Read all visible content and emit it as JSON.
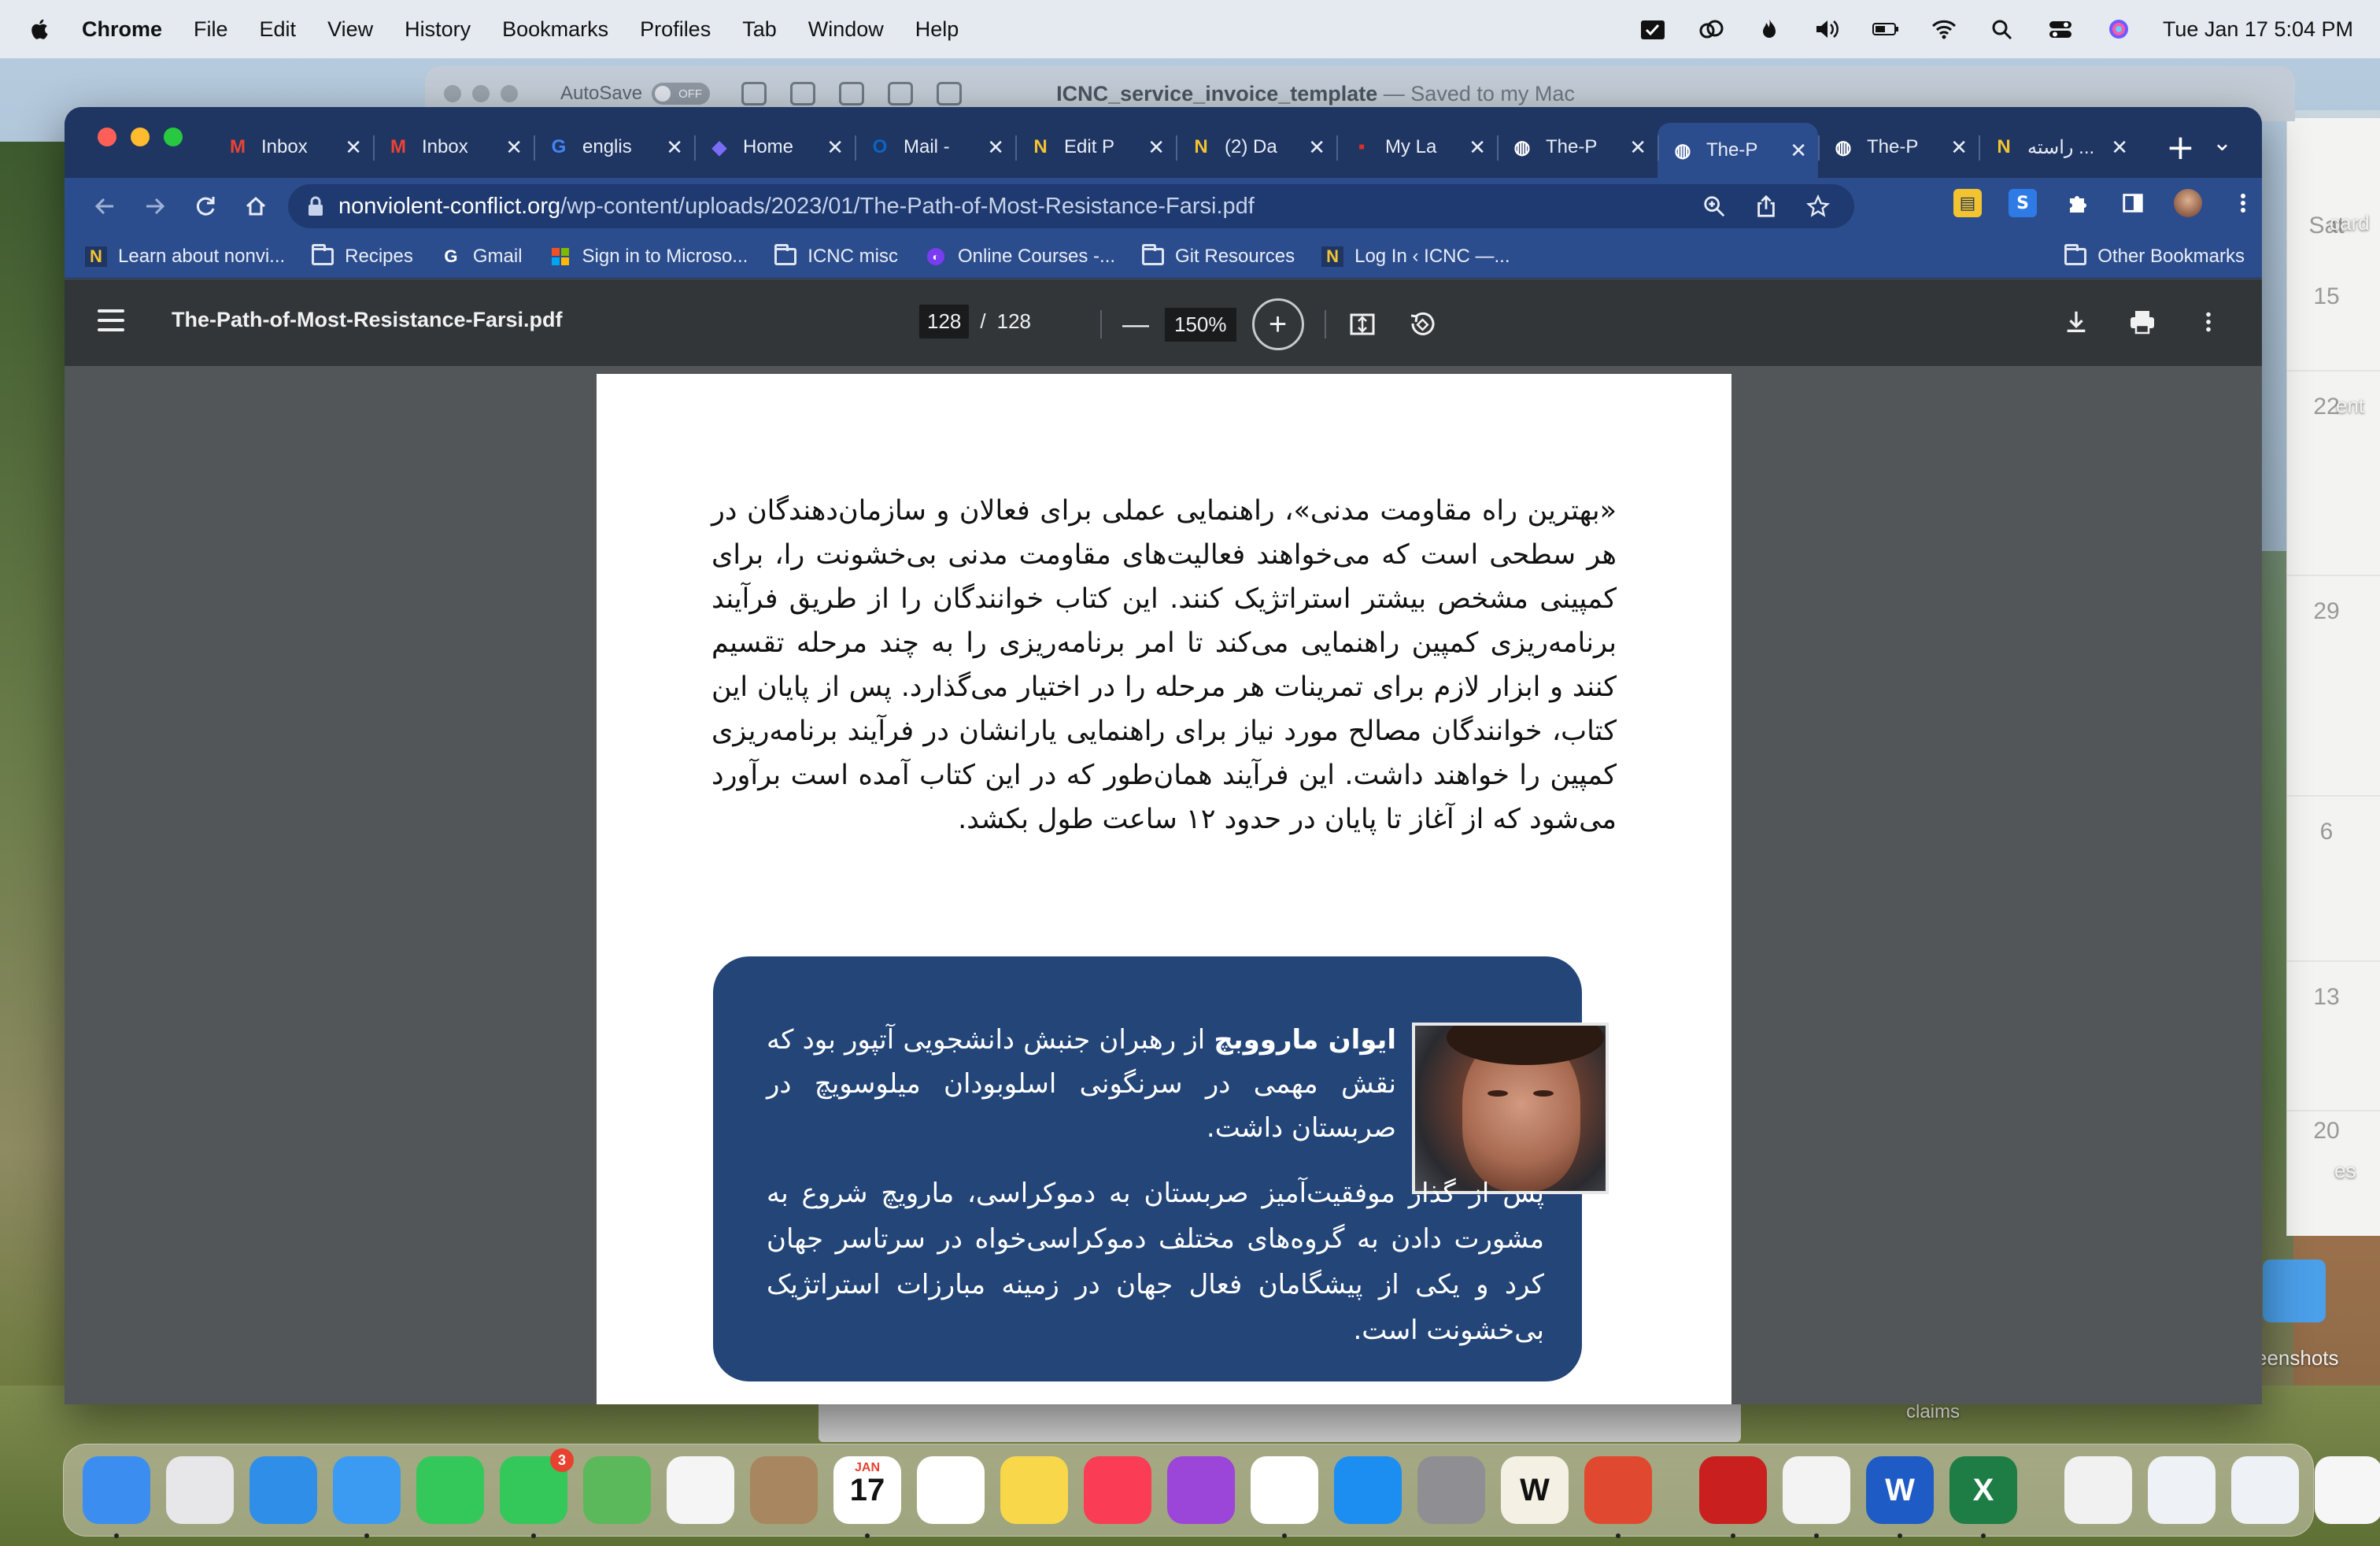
{
  "menubar": {
    "app_name": "Chrome",
    "items": [
      "File",
      "Edit",
      "View",
      "History",
      "Bookmarks",
      "Profiles",
      "Tab",
      "Window",
      "Help"
    ],
    "datetime": "Tue Jan 17  5:04 PM"
  },
  "back_window": {
    "autosave_label": "AutoSave",
    "toggle_label": "OFF",
    "doc_title": "ICNC_service_invoice_template",
    "doc_status": " — Saved to my Mac"
  },
  "side_window": {
    "label_card": "card",
    "label_sat": "Sat",
    "days": [
      "15",
      "22",
      "29",
      "6",
      "13",
      "20"
    ],
    "label_ent": "ent",
    "label_es": "es",
    "label_screenshots": "eenshots"
  },
  "tabs": [
    {
      "label": "Inbox",
      "icon": "gmail-icon",
      "color": "#ea4335"
    },
    {
      "label": "Inbox",
      "icon": "gmail-icon",
      "color": "#ea4335"
    },
    {
      "label": "englis",
      "icon": "google-icon",
      "color": "#4285f4"
    },
    {
      "label": "Home",
      "icon": "copilot-icon",
      "color": "#7b6cf6"
    },
    {
      "label": "Mail -",
      "icon": "outlook-icon",
      "color": "#0a64c8"
    },
    {
      "label": "Edit P",
      "icon": "n-icon",
      "color": "#f4c430"
    },
    {
      "label": "(2) Da",
      "icon": "n-icon",
      "color": "#f4c430"
    },
    {
      "label": "My La",
      "icon": "dots-icon",
      "color": "#d93025"
    },
    {
      "label": "The-P",
      "icon": "globe-icon",
      "color": "#ffffff"
    },
    {
      "label": "The-P",
      "icon": "globe-icon",
      "color": "#ffffff",
      "active": true
    },
    {
      "label": "The-P",
      "icon": "globe-icon",
      "color": "#ffffff"
    },
    {
      "label": "راسته ...",
      "icon": "n-icon",
      "color": "#f4c430"
    }
  ],
  "toolbar": {
    "url_host": "nonviolent-conflict.org",
    "url_path": "/wp-content/uploads/2023/01/The-Path-of-Most-Resistance-Farsi.pdf"
  },
  "bookmarks": [
    {
      "label": "Learn about nonvi...",
      "icon": "n-icon"
    },
    {
      "label": "Recipes",
      "icon": "folder-icon"
    },
    {
      "label": "Gmail",
      "icon": "google-icon"
    },
    {
      "label": "Sign in to Microso...",
      "icon": "microsoft-icon"
    },
    {
      "label": "ICNC misc",
      "icon": "folder-icon"
    },
    {
      "label": "Online Courses -...",
      "icon": "course-icon"
    },
    {
      "label": "Git Resources",
      "icon": "folder-icon"
    },
    {
      "label": "Log In ‹ ICNC —...",
      "icon": "n-icon"
    }
  ],
  "other_bookmarks": "Other Bookmarks",
  "pdf": {
    "filename": "The-Path-of-Most-Resistance-Farsi.pdf",
    "current_page": "128",
    "page_separator": "/",
    "total_pages": "128",
    "zoom": "150%",
    "body_text": "«بهترین راه مقاومت مدنی»، راهنمایی عملی برای فعالان و سازمان‌دهندگان در هر سطحی است که می‌خواهند فعالیت‌های مقاومت مدنی بی‌خشونت را، برای کمپینی مشخص بیشتر استراتژیک کنند. این کتاب خوانندگان را از طریق فرآیند برنامه‌ریزی کمپین راهنمایی می‌کند تا امر برنامه‌ریزی را به چند مرحله تقسیم کنند و ابزار لازم برای تمرینات هر مرحله را در اختیار می‌گذارد. پس از پایان این کتاب، خوانندگان مصالح مورد نیاز برای راهنمایی یارانشان در فرآیند برنامه‌ریزی کمپین را خواهند داشت. این فرآیند همان‌طور که در این کتاب آمده است برآورد می‌شود که از آغاز تا پایان در حدود ۱۲ ساعت طول بکشد.",
    "bio_name": "ایوان مارووبچ",
    "bio_text1": " از رهبران جنبش دانشجویی آتپور بود که نقش مهمی در سرنگونی اسلوبودان میلوسویچ در صربستان داشت.",
    "bio_text2": "پس از گذار موفقیت‌آمیز صربستان به دموکراسی، مارویچ شروع به مشورت دادن به گروه‌های مختلف دموکراسی‌خواه در سرتاسر جهان کرد و یکی از پیشگامان فعال جهان در زمینه مبارزات استراتژیک بی‌خشونت است."
  },
  "desktop": {
    "claims_label": "claims"
  },
  "dock": {
    "apps": [
      {
        "name": "finder",
        "color": "#3b8ef0"
      },
      {
        "name": "launchpad",
        "color": "#e7e7ea"
      },
      {
        "name": "safari",
        "color": "#2f8ee8"
      },
      {
        "name": "mail",
        "color": "#3b9bf2"
      },
      {
        "name": "facetime",
        "color": "#34c759"
      },
      {
        "name": "messages",
        "color": "#34c759",
        "badge": "3"
      },
      {
        "name": "maps",
        "color": "#5bb85b"
      },
      {
        "name": "photos",
        "color": "#f5f5f5"
      },
      {
        "name": "contacts",
        "color": "#a8865f"
      },
      {
        "name": "calendar",
        "color": "#ffffff",
        "text": "17",
        "month": "JAN"
      },
      {
        "name": "reminders",
        "color": "#ffffff"
      },
      {
        "name": "notes",
        "color": "#f8d84a"
      },
      {
        "name": "music",
        "color": "#fa3c55"
      },
      {
        "name": "podcasts",
        "color": "#9b45d9"
      },
      {
        "name": "chrome",
        "color": "#ffffff"
      },
      {
        "name": "app-store",
        "color": "#1c8ef2"
      },
      {
        "name": "system-settings",
        "color": "#8e8e93"
      },
      {
        "name": "word-game",
        "color": "#f4f0e4",
        "text": "W"
      },
      {
        "name": "remote-desktop",
        "color": "#e0492f"
      },
      {
        "name": "acrobat",
        "color": "#c9201f"
      },
      {
        "name": "textedit",
        "color": "#f3f3f3"
      },
      {
        "name": "word",
        "color": "#1f5bc4",
        "text": "W"
      },
      {
        "name": "excel",
        "color": "#1d7d45",
        "text": "X"
      },
      {
        "name": "doc-stack-1",
        "color": "#f1f1f1"
      },
      {
        "name": "doc-stack-2",
        "color": "#eef2f6"
      },
      {
        "name": "doc-stack-3",
        "color": "#eef2f6"
      },
      {
        "name": "doc-stack-4",
        "color": "#f6f6f6"
      },
      {
        "name": "trash",
        "color": "#d8dadd"
      }
    ]
  }
}
